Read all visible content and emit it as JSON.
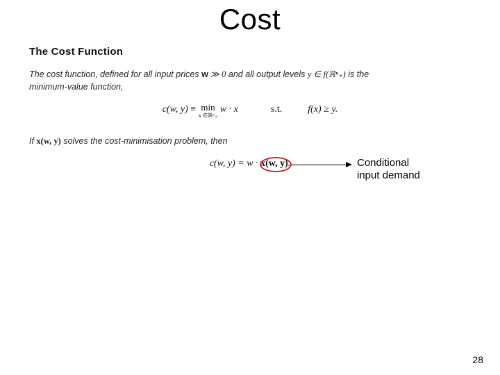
{
  "title": "Cost",
  "section_heading": "The Cost Function",
  "paragraph_line1_a": "The cost function, defined for all input prices ",
  "paragraph_line1_b": " and all output levels ",
  "paragraph_line1_c": " is the",
  "paragraph_line2": "minimum-value function,",
  "eq1": {
    "lhs": "c(w, y)",
    "equiv": "≡",
    "min_top": "min",
    "min_bottom": "x ∈ℝⁿ₊",
    "mid": "w · x",
    "st": "s.t.",
    "rhs": "f(x) ≥ y."
  },
  "paragraph_line3_a": "If ",
  "paragraph_line3_b": " solves the cost-minimisation problem, then",
  "eq2": {
    "full_lhs": "c(w, y)",
    "eq": "=",
    "rhs_a": "w · ",
    "rhs_b": "x(w, y)",
    "rhs_c": "."
  },
  "annotation_l1": "Conditional",
  "annotation_l2": "input demand",
  "math": {
    "w_bold": "w",
    "gg0": " ≫ 0",
    "y_in": "y ∈ f",
    "Rn": "(ℝⁿ₊)",
    "xwy": "x(w, y)"
  },
  "page_number": "28"
}
